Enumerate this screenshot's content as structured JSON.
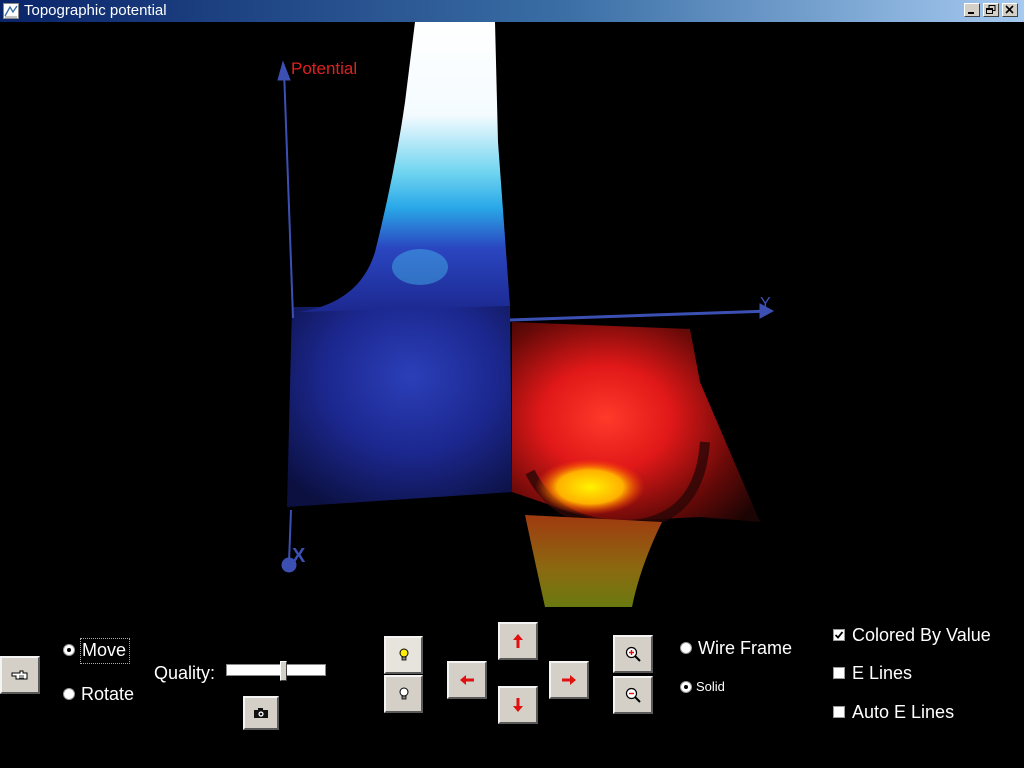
{
  "window": {
    "title": "Topographic potential"
  },
  "axes": {
    "potential_label": "Potential",
    "y_label": "Y",
    "x_label": "X"
  },
  "controls": {
    "mode_options": [
      "Move",
      "Rotate"
    ],
    "mode_selected": "Move",
    "quality_label": "Quality:",
    "quality_value": 0.58,
    "render_options": [
      "Wire Frame",
      "Solid"
    ],
    "render_selected": "Solid",
    "colored_by_value": {
      "label": "Colored By Value",
      "checked": true
    },
    "e_lines": {
      "label": "E Lines",
      "checked": false
    },
    "auto_e_lines": {
      "label": "Auto E Lines",
      "checked": false
    }
  },
  "colors": {
    "axis": "#3c50b4",
    "potential_label": "#e02020",
    "positive_peak": "#ffffff",
    "negative_well": "#ffd200",
    "button_face": "#d4d0c8"
  }
}
